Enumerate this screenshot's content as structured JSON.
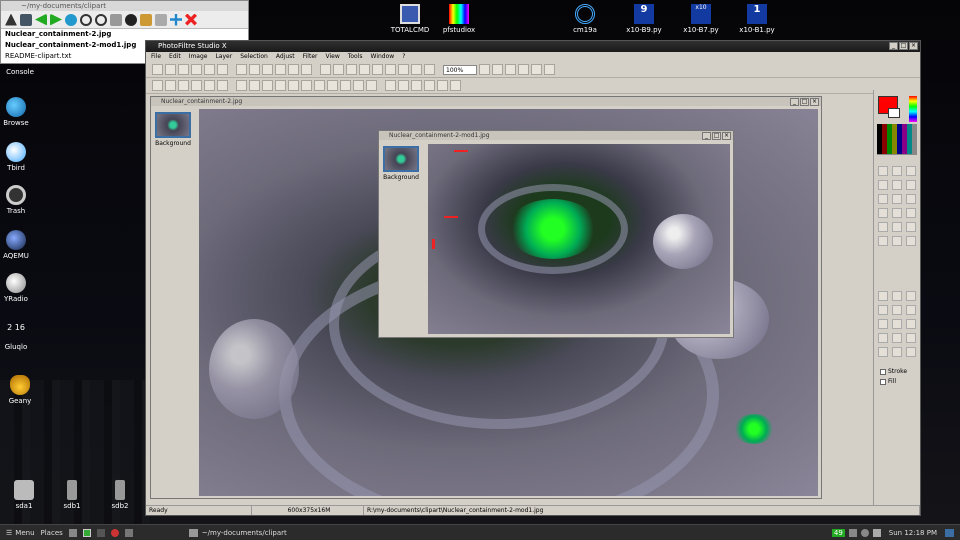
{
  "file_manager": {
    "title": "~/my-documents/clipart",
    "files": [
      "Nuclear_containment-2.jpg",
      "Nuclear_containment-2-mod1.jpg",
      "README-clipart.txt"
    ]
  },
  "desktop_left": [
    "Console",
    "Browse",
    "Tbird",
    "Trash",
    "AQEMU",
    "YRadio",
    "Gluqlo",
    "Geany"
  ],
  "clock_glyph": "2 16",
  "drives": [
    "sda1",
    "sdb1",
    "sdb2"
  ],
  "desktop_top": [
    "TOTALCMD",
    "pfstudiox",
    "cm19a",
    "x10-B9.py",
    "x10-B7.py",
    "x10-B1.py"
  ],
  "top_icon_glyphs": [
    "9",
    "x10",
    "1"
  ],
  "app": {
    "title": "PhotoFiltre Studio X",
    "menu": [
      "File",
      "Edit",
      "Image",
      "Layer",
      "Selection",
      "Adjust",
      "Filter",
      "View",
      "Tools",
      "Window",
      "?"
    ],
    "zoom": "100%",
    "doc1_title": "Nuclear_containment-2.jpg",
    "doc2_title": "Nuclear_containment-2-mod1.jpg",
    "layer_label": "Background",
    "status": {
      "state": "Ready",
      "size": "600x375x16M",
      "path": "R:\\my-documents\\clipart\\Nuclear_containment-2-mod1.jpg"
    },
    "stroke_label": "Stroke",
    "fill_label": "Fill"
  },
  "taskbar": {
    "menu": "Menu",
    "places": "Places",
    "task": "~/my-documents/clipart",
    "badge": "49",
    "clock": "Sun 12:18 PM"
  },
  "colors": {
    "foreground": "#ff0000",
    "background": "#ffffff",
    "taskbar": "#2b2b2b"
  }
}
